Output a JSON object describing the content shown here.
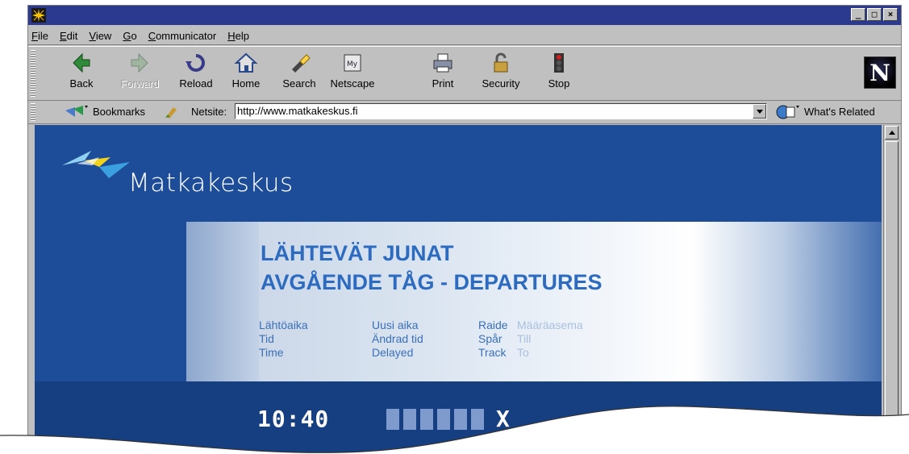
{
  "menu": [
    "File",
    "Edit",
    "View",
    "Go",
    "Communicator",
    "Help"
  ],
  "menu_underline": [
    "F",
    "E",
    "V",
    "G",
    "C",
    "H"
  ],
  "toolbar": {
    "back": "Back",
    "forward": "Forward",
    "reload": "Reload",
    "home": "Home",
    "search": "Search",
    "netscape": "Netscape",
    "print": "Print",
    "security": "Security",
    "stop": "Stop"
  },
  "logo_letter": "N",
  "location": {
    "bookmarks": "Bookmarks",
    "netsite_label": "Netsite:",
    "url": "http://www.matkakeskus.fi",
    "whats_related": "What's Related"
  },
  "page": {
    "brand": "Matkakeskus",
    "title_line1": "LÄHTEVÄT JUNAT",
    "title_line2": "AVGÅENDE TÅG - DEPARTURES",
    "col1": [
      "Lähtöaika",
      "Tid",
      "Time"
    ],
    "col2": [
      "Uusi aika",
      "Ändrad tid",
      "Delayed"
    ],
    "col3": [
      "Raide",
      "Spår",
      "Track"
    ],
    "col4": [
      "Määräasema",
      "Till",
      "To"
    ],
    "board_time": "10:40",
    "board_code": "X"
  },
  "colors": {
    "titlebar": "#2b3a8f",
    "content_bg": "#1d4d99",
    "heading": "#2d6bc0"
  }
}
